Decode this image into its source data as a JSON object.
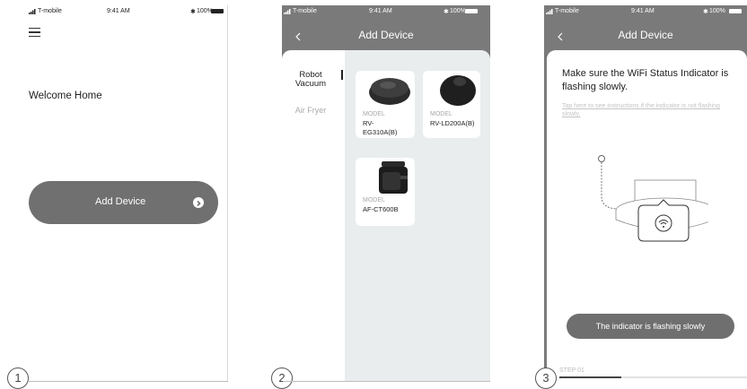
{
  "status": {
    "carrier": "T-mobile",
    "time": "9:41 AM",
    "battery": "100%"
  },
  "screen1": {
    "welcome": "Welcome Home",
    "add_device": "Add Device",
    "step_number": "1"
  },
  "screen2": {
    "title": "Add Device",
    "categories": [
      "Robot Vacuum",
      "Air Fryer"
    ],
    "devices": [
      {
        "model_label": "MODEL",
        "model": "RV-EG310A(B)"
      },
      {
        "model_label": "MODEL",
        "model": "RV-LD200A(B)"
      },
      {
        "model_label": "MODEL",
        "model": "AF-CT600B"
      }
    ],
    "step_number": "2"
  },
  "screen3": {
    "title": "Add Device",
    "heading": "Make sure the WiFi Status Indicator is flashing slowly.",
    "help_link": "Tap here to see instructions if the indicator is not flashing slowly.",
    "confirm_button": "The indicator is flashing slowly",
    "step_label": "STEP 01",
    "step_number": "3",
    "progress": 0.33
  },
  "icons": [
    "menu-icon",
    "back-chevron-icon",
    "arrow-right-icon",
    "wifi-icon",
    "signal-icon",
    "battery-icon",
    "bluetooth-icon"
  ],
  "colors": {
    "header": "#7a7a7a",
    "button": "#6f6f6f",
    "panel": "#e9edee"
  }
}
